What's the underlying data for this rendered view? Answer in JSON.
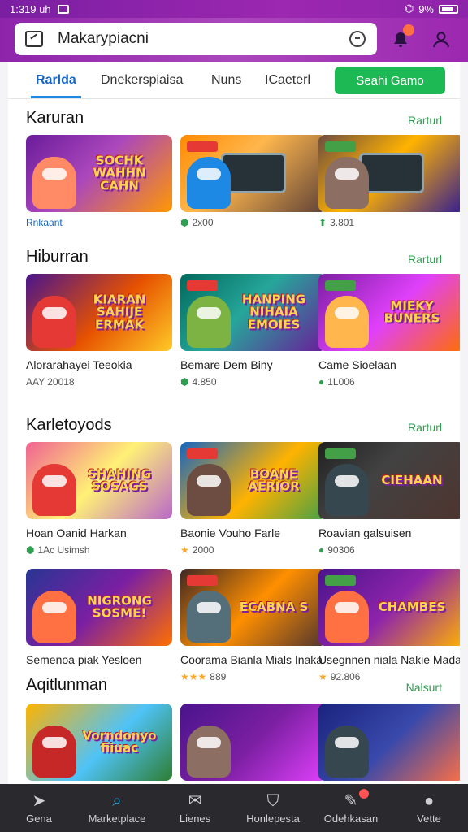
{
  "status_bar": {
    "time": "1:319 uh",
    "right": "9%"
  },
  "search": {
    "value": "Makarypiacni"
  },
  "header_icons": {
    "notification_badge": ""
  },
  "tabs": [
    {
      "label": "Rarlda",
      "active": true
    },
    {
      "label": "Dnekerspiaisa"
    },
    {
      "label": "Nuns"
    },
    {
      "label": "ICaeterl"
    }
  ],
  "action_button": "Seahi Gamo",
  "sections": [
    {
      "title": "Karuran",
      "see_all": "Rarturl",
      "cards": [
        {
          "thumb_text": "SOCHK WAHHN CAHN",
          "name": "",
          "meta": "Rnkaant",
          "meta_icon": "",
          "bg": "linear-gradient(135deg,#6a1b9a,#ab47bc 45%,#ff9800)",
          "char": "#ff8a65"
        },
        {
          "thumb_text": "",
          "name": "",
          "meta": "2x00",
          "meta_icon": "⬢",
          "bg": "linear-gradient(135deg,#ff8a00,#ffb74d 40%,#5d4037)",
          "char": "#1e88e5",
          "tablet": true
        },
        {
          "thumb_text": "",
          "name": "",
          "meta": "3.801",
          "meta_icon": "⬆",
          "bg": "linear-gradient(135deg,#6d4c41,#ffb300 45%,#311b92)",
          "char": "#8d6e63",
          "tablet": true
        }
      ]
    },
    {
      "title": "Hiburran",
      "see_all": "Rarturl",
      "cards": [
        {
          "thumb_text": "KIARAN SAHIJE ERMAK",
          "name": "Alorarahayei Teeokia",
          "meta": "AAY 20018",
          "meta_icon": "",
          "bg": "linear-gradient(135deg,#4a148c,#e65100 55%,#ffca28)",
          "char": "#e53935"
        },
        {
          "thumb_text": "HANPING NIHAIA EMOIES",
          "name": "Bemare Dem Biny",
          "meta": "4.850",
          "meta_icon": "⬢",
          "bg": "linear-gradient(135deg,#00695c,#26a69a 45%,#6a1b9a)",
          "char": "#7cb342"
        },
        {
          "thumb_text": "MIEKY BUNERS",
          "name": "Came Sioelaan",
          "meta": "1L006",
          "meta_icon": "●",
          "bg": "linear-gradient(135deg,#7b1fa2,#e040fb 50%,#ff6f00)",
          "char": "#ffb74d"
        }
      ]
    },
    {
      "title": "Karletoyods",
      "see_all": "Rarturl",
      "cards": [
        {
          "thumb_text": "SHAHING SOSAGS",
          "name": "Hoan Oanid Harkan",
          "meta": "1Ac Usimsh",
          "meta_icon": "⬢",
          "bg": "linear-gradient(135deg,#f06292,#fff176 50%,#ba68c8)",
          "char": "#e53935"
        },
        {
          "thumb_text": "BOANE AERIOR",
          "name": "Baonie Vouho Farle",
          "meta": "2000",
          "meta_icon": "★",
          "bg": "linear-gradient(135deg,#1565c0,#ffb300 55%,#43a047)",
          "char": "#6d4c41"
        },
        {
          "thumb_text": "CIEHAAN",
          "name": "Roavian galsuisen",
          "meta": "90306",
          "meta_icon": "●",
          "bg": "linear-gradient(135deg,#212121,#424242 40%,#4e342e)",
          "char": "#37474f"
        }
      ]
    },
    {
      "title": "",
      "see_all": "",
      "cards": [
        {
          "thumb_text": "NIGRONG SOSME!",
          "name": "Semenoa piak Yesloen",
          "meta": "",
          "meta_icon": "",
          "bg": "linear-gradient(135deg,#283593,#7b1fa2 50%,#ff6f00)",
          "char": "#ff7043"
        },
        {
          "thumb_text": "ECABNA S",
          "name": "Coorama Bianla Mials Inaka",
          "meta": "889",
          "meta_icon": "★★★",
          "bg": "linear-gradient(135deg,#3e2723,#ff8f00 50%,#4e342e)",
          "char": "#546e7a"
        },
        {
          "thumb_text": "CHAMBES",
          "name": "Usegnnen niala Nakie Mada",
          "meta": "92.806",
          "meta_icon": "★",
          "bg": "linear-gradient(135deg,#4a148c,#8e24aa 50%,#ffb300)",
          "char": "#ff7043"
        }
      ]
    },
    {
      "title": "Aqitlunman",
      "see_all": "Nalsurt",
      "cards": [
        {
          "thumb_text": "Vorndonyo fiiuac",
          "name": "",
          "meta": "",
          "meta_icon": "",
          "bg": "linear-gradient(135deg,#ffb300,#4fc3f7 55%,#2e7d32)",
          "char": "#c62828"
        },
        {
          "thumb_text": "",
          "name": "",
          "meta": "",
          "meta_icon": "",
          "bg": "linear-gradient(135deg,#4a148c,#7b1fa2 50%,#e040fb)",
          "char": "#8d6e63"
        },
        {
          "thumb_text": "",
          "name": "",
          "meta": "",
          "meta_icon": "",
          "bg": "linear-gradient(135deg,#1a237e,#3949ab 50%,#ff7043)",
          "char": "#37474f"
        }
      ]
    }
  ],
  "bottom_nav": [
    {
      "label": "Gena",
      "icon": "➤"
    },
    {
      "label": "Marketplace",
      "icon": "⌕",
      "active": true
    },
    {
      "label": "Lienes",
      "icon": "✉"
    },
    {
      "label": "Honlepesta",
      "icon": "⛉"
    },
    {
      "label": "Odehkasan",
      "icon": "✎",
      "badge": true
    },
    {
      "label": "Vette",
      "icon": "●"
    }
  ],
  "colors": {
    "accent": "#1e88e5",
    "primary_button": "#1db954",
    "header": "#9c27b0"
  }
}
